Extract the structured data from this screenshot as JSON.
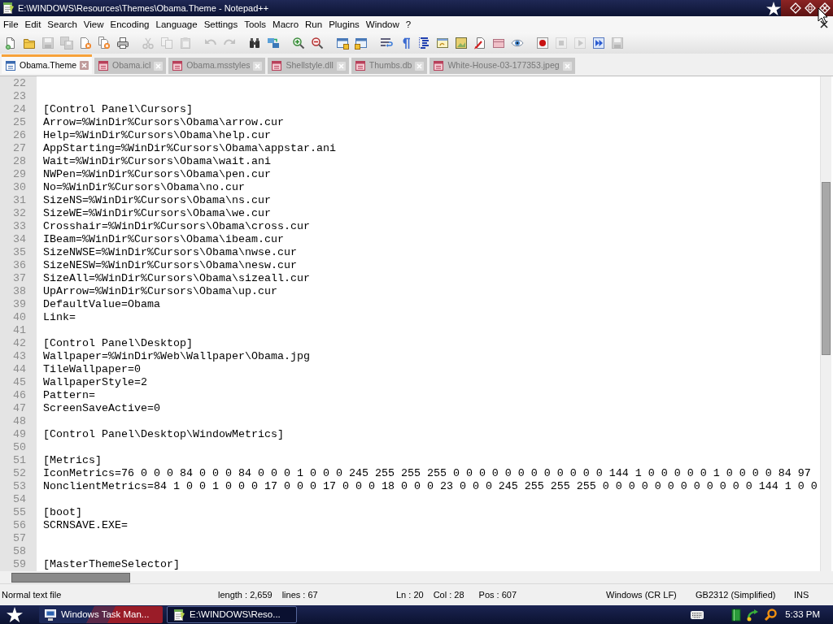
{
  "window": {
    "title": "E:\\WINDOWS\\Resources\\Themes\\Obama.Theme - Notepad++"
  },
  "menu": [
    "File",
    "Edit",
    "Search",
    "View",
    "Encoding",
    "Language",
    "Settings",
    "Tools",
    "Macro",
    "Run",
    "Plugins",
    "Window",
    "?"
  ],
  "toolbar": [
    [
      {
        "kind": "new",
        "disabled": false
      },
      {
        "kind": "open",
        "disabled": false
      },
      {
        "kind": "save",
        "disabled": true
      },
      {
        "kind": "saveall",
        "disabled": true
      },
      {
        "kind": "close",
        "disabled": false
      },
      {
        "kind": "closeall",
        "disabled": false
      },
      {
        "kind": "print",
        "disabled": false
      }
    ],
    [
      {
        "kind": "cut",
        "disabled": true
      },
      {
        "kind": "copy",
        "disabled": true
      },
      {
        "kind": "paste",
        "disabled": true
      }
    ],
    [
      {
        "kind": "undo",
        "disabled": true
      },
      {
        "kind": "redo",
        "disabled": true
      }
    ],
    [
      {
        "kind": "find",
        "disabled": false
      },
      {
        "kind": "replace",
        "disabled": false
      }
    ],
    [
      {
        "kind": "zoomin",
        "disabled": false
      },
      {
        "kind": "zoomout",
        "disabled": false
      }
    ],
    [
      {
        "kind": "syncv",
        "disabled": false
      },
      {
        "kind": "synch",
        "disabled": false
      }
    ],
    [
      {
        "kind": "wrap",
        "disabled": false
      },
      {
        "kind": "allchars",
        "disabled": false
      },
      {
        "kind": "indent",
        "disabled": false
      },
      {
        "kind": "udl",
        "disabled": false
      },
      {
        "kind": "docmap",
        "disabled": false
      },
      {
        "kind": "funclist",
        "disabled": false
      },
      {
        "kind": "folder",
        "disabled": false
      },
      {
        "kind": "monitor",
        "disabled": false
      }
    ],
    [
      {
        "kind": "record",
        "disabled": false
      },
      {
        "kind": "stop",
        "disabled": true
      },
      {
        "kind": "play",
        "disabled": true
      },
      {
        "kind": "playmulti",
        "disabled": false
      },
      {
        "kind": "savemacro",
        "disabled": true
      }
    ]
  ],
  "tabs": [
    {
      "label": "Obama.Theme",
      "selected": true,
      "modified": false
    },
    {
      "label": "Obama.icl",
      "selected": false,
      "modified": true
    },
    {
      "label": "Obama.msstyles",
      "selected": false,
      "modified": true
    },
    {
      "label": "Shellstyle.dll",
      "selected": false,
      "modified": true
    },
    {
      "label": "Thumbs.db",
      "selected": false,
      "modified": true
    },
    {
      "label": "White-House-03-177353.jpeg",
      "selected": false,
      "modified": true
    }
  ],
  "editor": {
    "lines": [
      {
        "number": "22"
      },
      {
        "number": "23"
      },
      {
        "number": "24",
        "text": "[Control Panel\\Cursors]"
      },
      {
        "number": "25",
        "text": "Arrow=%WinDir%Cursors\\Obama\\arrow.cur"
      },
      {
        "number": "26",
        "text": "Help=%WinDir%Cursors\\Obama\\help.cur"
      },
      {
        "number": "27",
        "text": "AppStarting=%WinDir%Cursors\\Obama\\appstar.ani"
      },
      {
        "number": "28",
        "text": "Wait=%WinDir%Cursors\\Obama\\wait.ani"
      },
      {
        "number": "29",
        "text": "NWPen=%WinDir%Cursors\\Obama\\pen.cur"
      },
      {
        "number": "30",
        "text": "No=%WinDir%Cursors\\Obama\\no.cur"
      },
      {
        "number": "31",
        "text": "SizeNS=%WinDir%Cursors\\Obama\\ns.cur"
      },
      {
        "number": "32",
        "text": "SizeWE=%WinDir%Cursors\\Obama\\we.cur"
      },
      {
        "number": "33",
        "text": "Crosshair=%WinDir%Cursors\\Obama\\cross.cur"
      },
      {
        "number": "34",
        "text": "IBeam=%WinDir%Cursors\\Obama\\ibeam.cur"
      },
      {
        "number": "35",
        "text": "SizeNWSE=%WinDir%Cursors\\Obama\\nwse.cur"
      },
      {
        "number": "36",
        "text": "SizeNESW=%WinDir%Cursors\\Obama\\nesw.cur"
      },
      {
        "number": "37",
        "text": "SizeAll=%WinDir%Cursors\\Obama\\sizeall.cur"
      },
      {
        "number": "38",
        "text": "UpArrow=%WinDir%Cursors\\Obama\\up.cur"
      },
      {
        "number": "39",
        "text": "DefaultValue=Obama"
      },
      {
        "number": "40",
        "text": "Link="
      },
      {
        "number": "41"
      },
      {
        "number": "42",
        "text": "[Control Panel\\Desktop]"
      },
      {
        "number": "43",
        "text": "Wallpaper=%WinDir%Web\\Wallpaper\\Obama.jpg"
      },
      {
        "number": "44",
        "text": "TileWallpaper=0"
      },
      {
        "number": "45",
        "text": "WallpaperStyle=2"
      },
      {
        "number": "46",
        "text": "Pattern="
      },
      {
        "number": "47",
        "text": "ScreenSaveActive=0"
      },
      {
        "number": "48"
      },
      {
        "number": "49",
        "text": "[Control Panel\\Desktop\\WindowMetrics]"
      },
      {
        "number": "50"
      },
      {
        "number": "51",
        "text": "[Metrics]"
      },
      {
        "number": "52",
        "text": "IconMetrics=76 0 0 0 84 0 0 0 84 0 0 0 1 0 0 0 245 255 255 255 0 0 0 0 0 0 0 0 0 0 0 0 144 1 0 0 0 0 0 1 0 0 0 0 84 97"
      },
      {
        "number": "53",
        "text": "NonclientMetrics=84 1 0 0 1 0 0 0 17 0 0 0 17 0 0 0 18 0 0 0 23 0 0 0 245 255 255 255 0 0 0 0 0 0 0 0 0 0 0 0 144 1 0 0"
      },
      {
        "number": "54"
      },
      {
        "number": "55",
        "text": "[boot]"
      },
      {
        "number": "56",
        "text": "SCRNSAVE.EXE="
      },
      {
        "number": "57"
      },
      {
        "number": "58"
      },
      {
        "number": "59",
        "text": "[MasterThemeSelector]"
      }
    ]
  },
  "status_bar": {
    "file_type": "Normal text file",
    "length": "length : 2,659",
    "lines": "lines : 67",
    "ln": "Ln : 20",
    "col": "Col : 28",
    "pos": "Pos : 607",
    "eol": "Windows (CR LF)",
    "encoding": "GB2312 (Simplified)",
    "mode": "INS"
  },
  "taskbar": {
    "tasks": [
      {
        "label": "Windows Task Man...",
        "kind": "computer",
        "selected": false
      },
      {
        "label": "E:\\WINDOWS\\Reso...",
        "kind": "notepad",
        "selected": true
      }
    ],
    "clock": "5:33 PM"
  }
}
